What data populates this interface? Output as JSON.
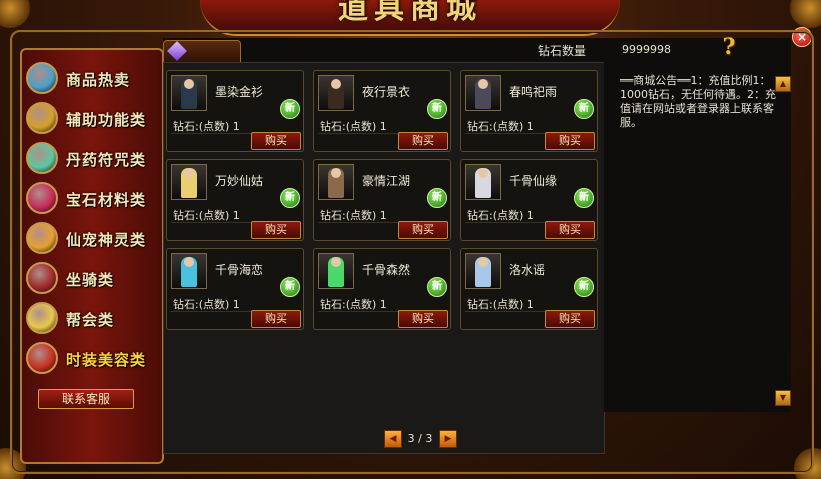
{
  "window": {
    "title": "道具商城",
    "close_label": "×"
  },
  "header": {
    "balance_label": "钻石数量",
    "balance_value": "9999998",
    "help_icon": "?"
  },
  "sidebar": {
    "items": [
      {
        "label": "商品热卖",
        "icon": "hot-items-icon",
        "color": "#4aa0c8"
      },
      {
        "label": "辅助功能类",
        "icon": "scroll-icon",
        "color": "#d4a02a"
      },
      {
        "label": "丹药符咒类",
        "icon": "pill-icon",
        "color": "#5ac8a0"
      },
      {
        "label": "宝石材料类",
        "icon": "gem-icon",
        "color": "#c82a5a"
      },
      {
        "label": "仙宠神灵类",
        "icon": "pet-icon",
        "color": "#e8a030"
      },
      {
        "label": "坐骑类",
        "icon": "mount-icon",
        "color": "#a02a2a"
      },
      {
        "label": "帮会类",
        "icon": "guild-icon",
        "color": "#e8c84a"
      },
      {
        "label": "时装美容类",
        "icon": "fashion-icon",
        "color": "#c83020",
        "active": true
      }
    ],
    "contact_label": "联系客服"
  },
  "items": [
    {
      "name": "墨染金衫",
      "price": "钻石:(点数) 1",
      "badge": "新",
      "buy": "购买",
      "color": "#2a3a4a"
    },
    {
      "name": "夜行景衣",
      "price": "钻石:(点数) 1",
      "badge": "新",
      "buy": "购买",
      "color": "#3a2a20"
    },
    {
      "name": "春鸣祀雨",
      "price": "钻石:(点数) 1",
      "badge": "新",
      "buy": "购买",
      "color": "#4a4a5a"
    },
    {
      "name": "万妙仙姑",
      "price": "钻石:(点数) 1",
      "badge": "新",
      "buy": "购买",
      "color": "#e8d070"
    },
    {
      "name": "豪情江湖",
      "price": "钻石:(点数) 1",
      "badge": "新",
      "buy": "购买",
      "color": "#8a6a4a"
    },
    {
      "name": "千骨仙缘",
      "price": "钻石:(点数) 1",
      "badge": "新",
      "buy": "购买",
      "color": "#d8d8e0"
    },
    {
      "name": "千骨海恋",
      "price": "钻石:(点数) 1",
      "badge": "新",
      "buy": "购买",
      "color": "#4ac0e0"
    },
    {
      "name": "千骨森然",
      "price": "钻石:(点数) 1",
      "badge": "新",
      "buy": "购买",
      "color": "#4ad86a"
    },
    {
      "name": "洛水谣",
      "price": "钻石:(点数) 1",
      "badge": "新",
      "buy": "购买",
      "color": "#a8c8e8"
    }
  ],
  "notice": {
    "text": "══商城公告══1：充值比例1：1000钻石，无任何待遇。2：充值请在网站或者登录器上联系客服。"
  },
  "pager": {
    "text": "3 / 3",
    "prev": "◀",
    "next": "▶"
  }
}
